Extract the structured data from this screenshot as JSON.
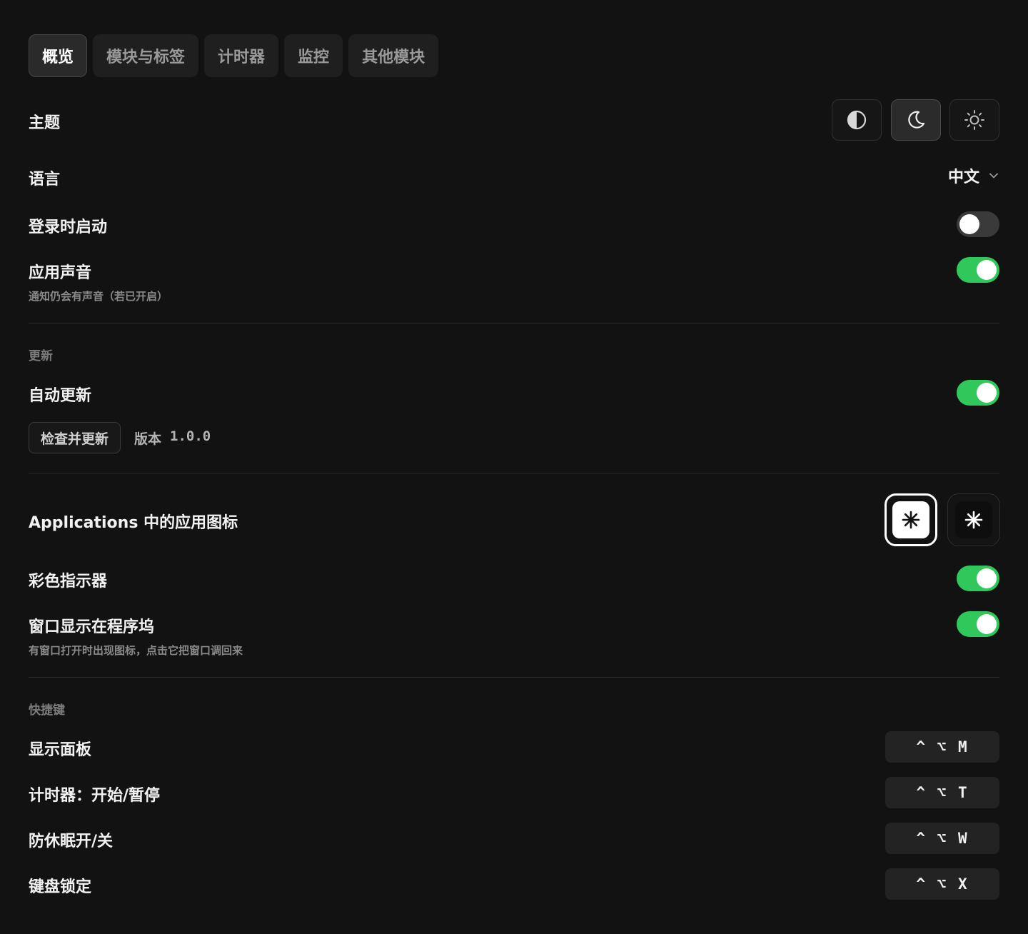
{
  "tabs": [
    {
      "label": "概览",
      "active": true
    },
    {
      "label": "模块与标签",
      "active": false
    },
    {
      "label": "计时器",
      "active": false
    },
    {
      "label": "监控",
      "active": false
    },
    {
      "label": "其他模块",
      "active": false
    }
  ],
  "theme": {
    "label": "主题",
    "options": [
      {
        "icon": "half-circle-contrast-icon",
        "active": false
      },
      {
        "icon": "moon-icon",
        "active": true
      },
      {
        "icon": "sun-icon",
        "active": false
      }
    ]
  },
  "language": {
    "label": "语言",
    "value": "中文",
    "icon": "chevron-down-icon"
  },
  "launch_at_login": {
    "label": "登录时启动",
    "enabled": false
  },
  "app_sounds": {
    "label": "应用声音",
    "description": "通知仍会有声音（若已开启）",
    "enabled": true
  },
  "updates": {
    "section_title": "更新",
    "auto_update": {
      "label": "自动更新",
      "enabled": true
    },
    "check_button": "检查并更新",
    "version_label": "版本",
    "version_number": "1.0.0"
  },
  "app_icon": {
    "label": "Applications 中的应用图标",
    "options": [
      {
        "style": "light",
        "icon": "asterisk-icon",
        "selected": true
      },
      {
        "style": "dark",
        "icon": "asterisk-icon",
        "selected": false
      }
    ]
  },
  "colored_indicator": {
    "label": "彩色指示器",
    "enabled": true
  },
  "show_in_dock": {
    "label": "窗口显示在程序坞",
    "description": "有窗口打开时出现图标，点击它把窗口调回来",
    "enabled": true
  },
  "shortcuts": {
    "section_title": "快捷键",
    "items": [
      {
        "label": "显示面板",
        "keys": "^ ⌥ M"
      },
      {
        "label": "计时器：开始/暂停",
        "keys": "^ ⌥ T"
      },
      {
        "label": "防休眠开/关",
        "keys": "^ ⌥ W"
      },
      {
        "label": "键盘锁定",
        "keys": "^ ⌥ X"
      }
    ]
  },
  "colors": {
    "accent_green": "#30c85a",
    "background": "#121212"
  }
}
